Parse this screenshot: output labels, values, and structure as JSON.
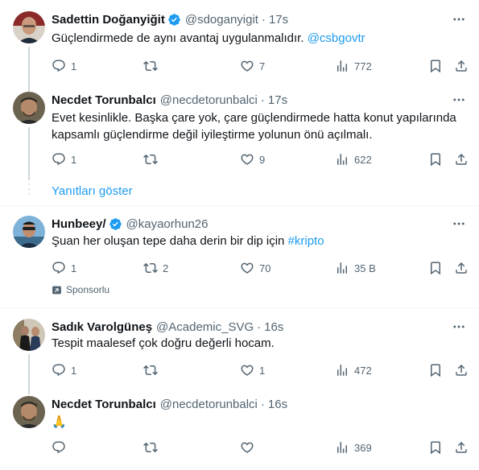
{
  "posts": [
    {
      "name": "Sadettin Doğanyiğit",
      "verified": true,
      "handle": "@sdoganyigit",
      "time": "17s",
      "text": "Güçlendirmede de aynı avantaj uygulanmalıdır.",
      "link": "@csbgovtr",
      "replies": "1",
      "reposts": "",
      "likes": "7",
      "views": "772"
    },
    {
      "name": "Necdet Torunbalcı",
      "verified": false,
      "handle": "@necdetorunbalci",
      "time": "17s",
      "text_line1": "Evet kesinlikle. Başka çare yok, çare güçlendirmede hatta konut  yapılarında",
      "text_line2": "kapsamlı güçlendirme değil iyileştirme yolunun önü açılmalı.",
      "replies": "1",
      "reposts": "",
      "likes": "9",
      "views": "622"
    },
    {
      "name": "Hunbeey/",
      "verified": true,
      "handle": "@kayaorhun26",
      "time": "",
      "text": "Şuan her oluşan tepe daha derin bir dip için",
      "link": "#kripto",
      "replies": "1",
      "reposts": "2",
      "likes": "70",
      "views": "35 B",
      "sponsored": "Sponsorlu"
    },
    {
      "name": "Sadık Varolgüneş",
      "verified": false,
      "handle": "@Academic_SVG",
      "time": "16s",
      "text": "Tespit maalesef çok doğru değerli hocam.",
      "replies": "1",
      "reposts": "",
      "likes": "1",
      "views": "472"
    },
    {
      "name": "Necdet Torunbalcı",
      "verified": false,
      "handle": "@necdetorunbalci",
      "time": "16s",
      "text": "🙏",
      "replies": "",
      "reposts": "",
      "likes": "",
      "views": "369"
    }
  ],
  "show_replies": "Yanıtları göster",
  "colors": {
    "accent": "#1d9bf0",
    "muted": "#536471",
    "divider": "#eff3f4"
  },
  "icons": [
    "reply-icon",
    "repost-icon",
    "like-icon",
    "views-icon",
    "bookmark-icon",
    "share-icon",
    "more-icon",
    "verified-icon",
    "ad-icon"
  ]
}
